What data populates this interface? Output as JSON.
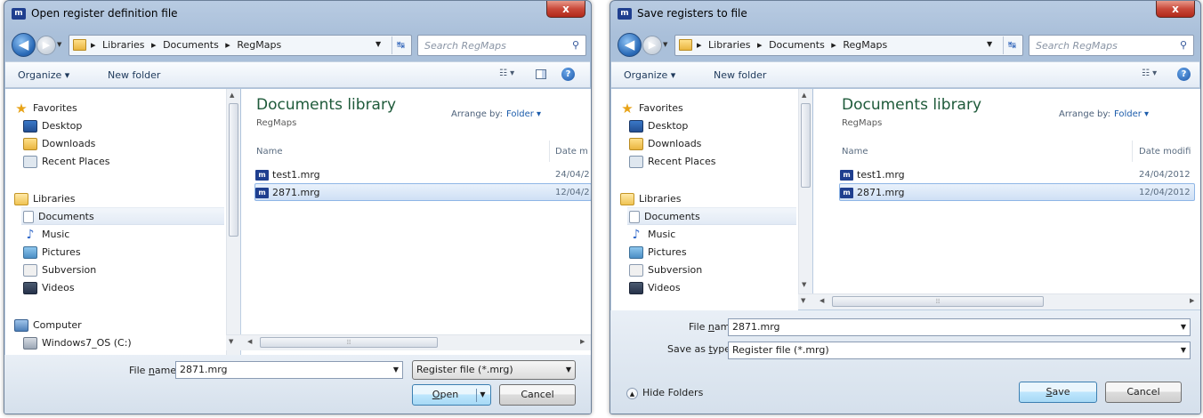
{
  "open_dialog": {
    "title": "Open register definition file",
    "close": "x",
    "breadcrumbs": [
      "Libraries",
      "Documents",
      "RegMaps"
    ],
    "search_placeholder": "Search RegMaps",
    "toolbar": {
      "organize": "Organize ▾",
      "new_folder": "New folder"
    },
    "nav": [
      {
        "label": "Favorites",
        "icon": "star-icon"
      },
      {
        "label": "Desktop",
        "icon": "desktop-icon"
      },
      {
        "label": "Downloads",
        "icon": "downloads-icon"
      },
      {
        "label": "Recent Places",
        "icon": "recent-places-icon"
      },
      {
        "label": "Libraries",
        "icon": "libraries-icon"
      },
      {
        "label": "Documents",
        "icon": "documents-icon",
        "selected": true
      },
      {
        "label": "Music",
        "icon": "music-icon"
      },
      {
        "label": "Pictures",
        "icon": "pictures-icon"
      },
      {
        "label": "Subversion",
        "icon": "subversion-icon"
      },
      {
        "label": "Videos",
        "icon": "videos-icon"
      },
      {
        "label": "Computer",
        "icon": "computer-icon"
      },
      {
        "label": "Windows7_OS (C:)",
        "icon": "drive-icon"
      }
    ],
    "library_title": "Documents library",
    "library_sub": "RegMaps",
    "arrange_label": "Arrange by:",
    "arrange_value": "Folder ▾",
    "col_name": "Name",
    "col_date": "Date m",
    "files": [
      {
        "name": "test1.mrg",
        "date": "24/04/2"
      },
      {
        "name": "2871.mrg",
        "date": "12/04/2",
        "selected": true
      }
    ],
    "file_name_label_pre": "File ",
    "file_name_label_u": "n",
    "file_name_label_post": "ame:",
    "file_name_value": "2871.mrg",
    "file_type": "Register file (*.mrg)",
    "open_u": "O",
    "open_rest": "pen",
    "cancel": "Cancel"
  },
  "save_dialog": {
    "title": "Save registers to file",
    "close": "x",
    "breadcrumbs": [
      "Libraries",
      "Documents",
      "RegMaps"
    ],
    "search_placeholder": "Search RegMaps",
    "toolbar": {
      "organize": "Organize ▾",
      "new_folder": "New folder"
    },
    "nav": [
      {
        "label": "Favorites",
        "icon": "star-icon"
      },
      {
        "label": "Desktop",
        "icon": "desktop-icon"
      },
      {
        "label": "Downloads",
        "icon": "downloads-icon"
      },
      {
        "label": "Recent Places",
        "icon": "recent-places-icon"
      },
      {
        "label": "Libraries",
        "icon": "libraries-icon"
      },
      {
        "label": "Documents",
        "icon": "documents-icon",
        "selected": true
      },
      {
        "label": "Music",
        "icon": "music-icon"
      },
      {
        "label": "Pictures",
        "icon": "pictures-icon"
      },
      {
        "label": "Subversion",
        "icon": "subversion-icon"
      },
      {
        "label": "Videos",
        "icon": "videos-icon"
      }
    ],
    "library_title": "Documents library",
    "library_sub": "RegMaps",
    "arrange_label": "Arrange by:",
    "arrange_value": "Folder ▾",
    "col_name": "Name",
    "col_date": "Date modifi",
    "files": [
      {
        "name": "test1.mrg",
        "date": "24/04/2012"
      },
      {
        "name": "2871.mrg",
        "date": "12/04/2012",
        "selected": true
      }
    ],
    "file_name_label_pre": "File ",
    "file_name_label_u": "n",
    "file_name_label_post": "ame:",
    "file_name_value": "2871.mrg",
    "save_type_label_pre": "Save as ",
    "save_type_label_u": "t",
    "save_type_label_post": "ype:",
    "save_type_value": "Register file (*.mrg)",
    "hide_folders": "Hide Folders",
    "save_u": "S",
    "save_rest": "ave",
    "cancel": "Cancel"
  }
}
